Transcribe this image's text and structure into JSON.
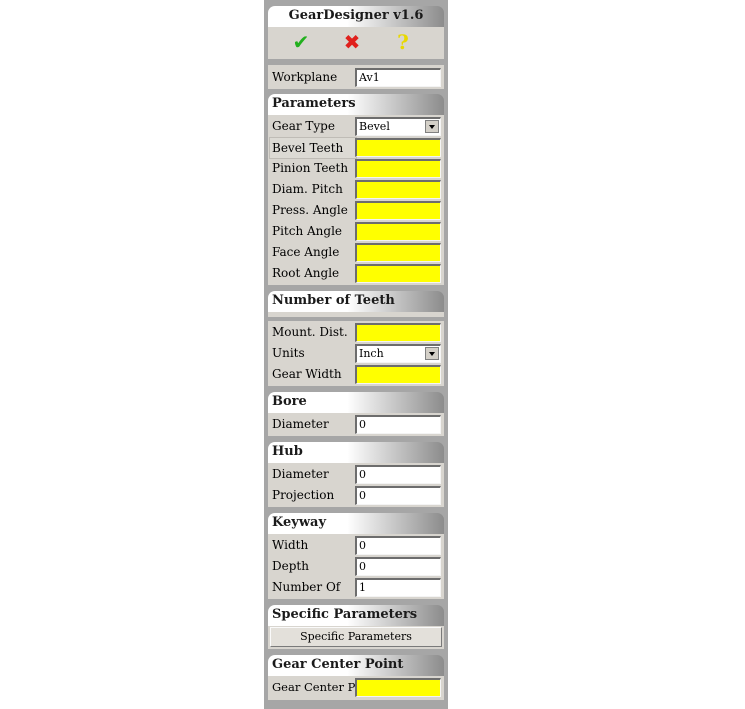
{
  "title": "GearDesigner v1.6",
  "icons": [
    "check-icon",
    "cancel-x-icon",
    "help-question-icon"
  ],
  "colors": {
    "required_field": "#ffff00",
    "panel_bg": "#a6a6a6",
    "section_bg": "#d8d5cf"
  },
  "workplane": {
    "label": "Workplane",
    "value": "Av1"
  },
  "parameters": {
    "header": "Parameters",
    "gear_type": {
      "label": "Gear Type",
      "value": "Bevel"
    },
    "bevel_teeth": "Bevel Teeth",
    "pinion_teeth": "Pinion Teeth",
    "diam_pitch": "Diam. Pitch",
    "press_angle": "Press. Angle",
    "pitch_angle": "Pitch Angle",
    "face_angle": "Face Angle",
    "root_angle": "Root Angle"
  },
  "number_of_teeth": {
    "header": "Number of Teeth",
    "mount_dist": "Mount. Dist.",
    "units": {
      "label": "Units",
      "value": "Inch"
    },
    "gear_width": "Gear Width"
  },
  "bore": {
    "header": "Bore",
    "diameter": {
      "label": "Diameter",
      "value": "0"
    }
  },
  "hub": {
    "header": "Hub",
    "diameter": {
      "label": "Diameter",
      "value": "0"
    },
    "projection": {
      "label": "Projection",
      "value": "0"
    }
  },
  "keyway": {
    "header": "Keyway",
    "width": {
      "label": "Width",
      "value": "0"
    },
    "depth": {
      "label": "Depth",
      "value": "0"
    },
    "number_of": {
      "label": "Number Of",
      "value": "1"
    }
  },
  "specific": {
    "header": "Specific Parameters",
    "button": "Specific Parameters"
  },
  "center": {
    "header": "Gear Center Point",
    "label": "Gear Center Point"
  }
}
